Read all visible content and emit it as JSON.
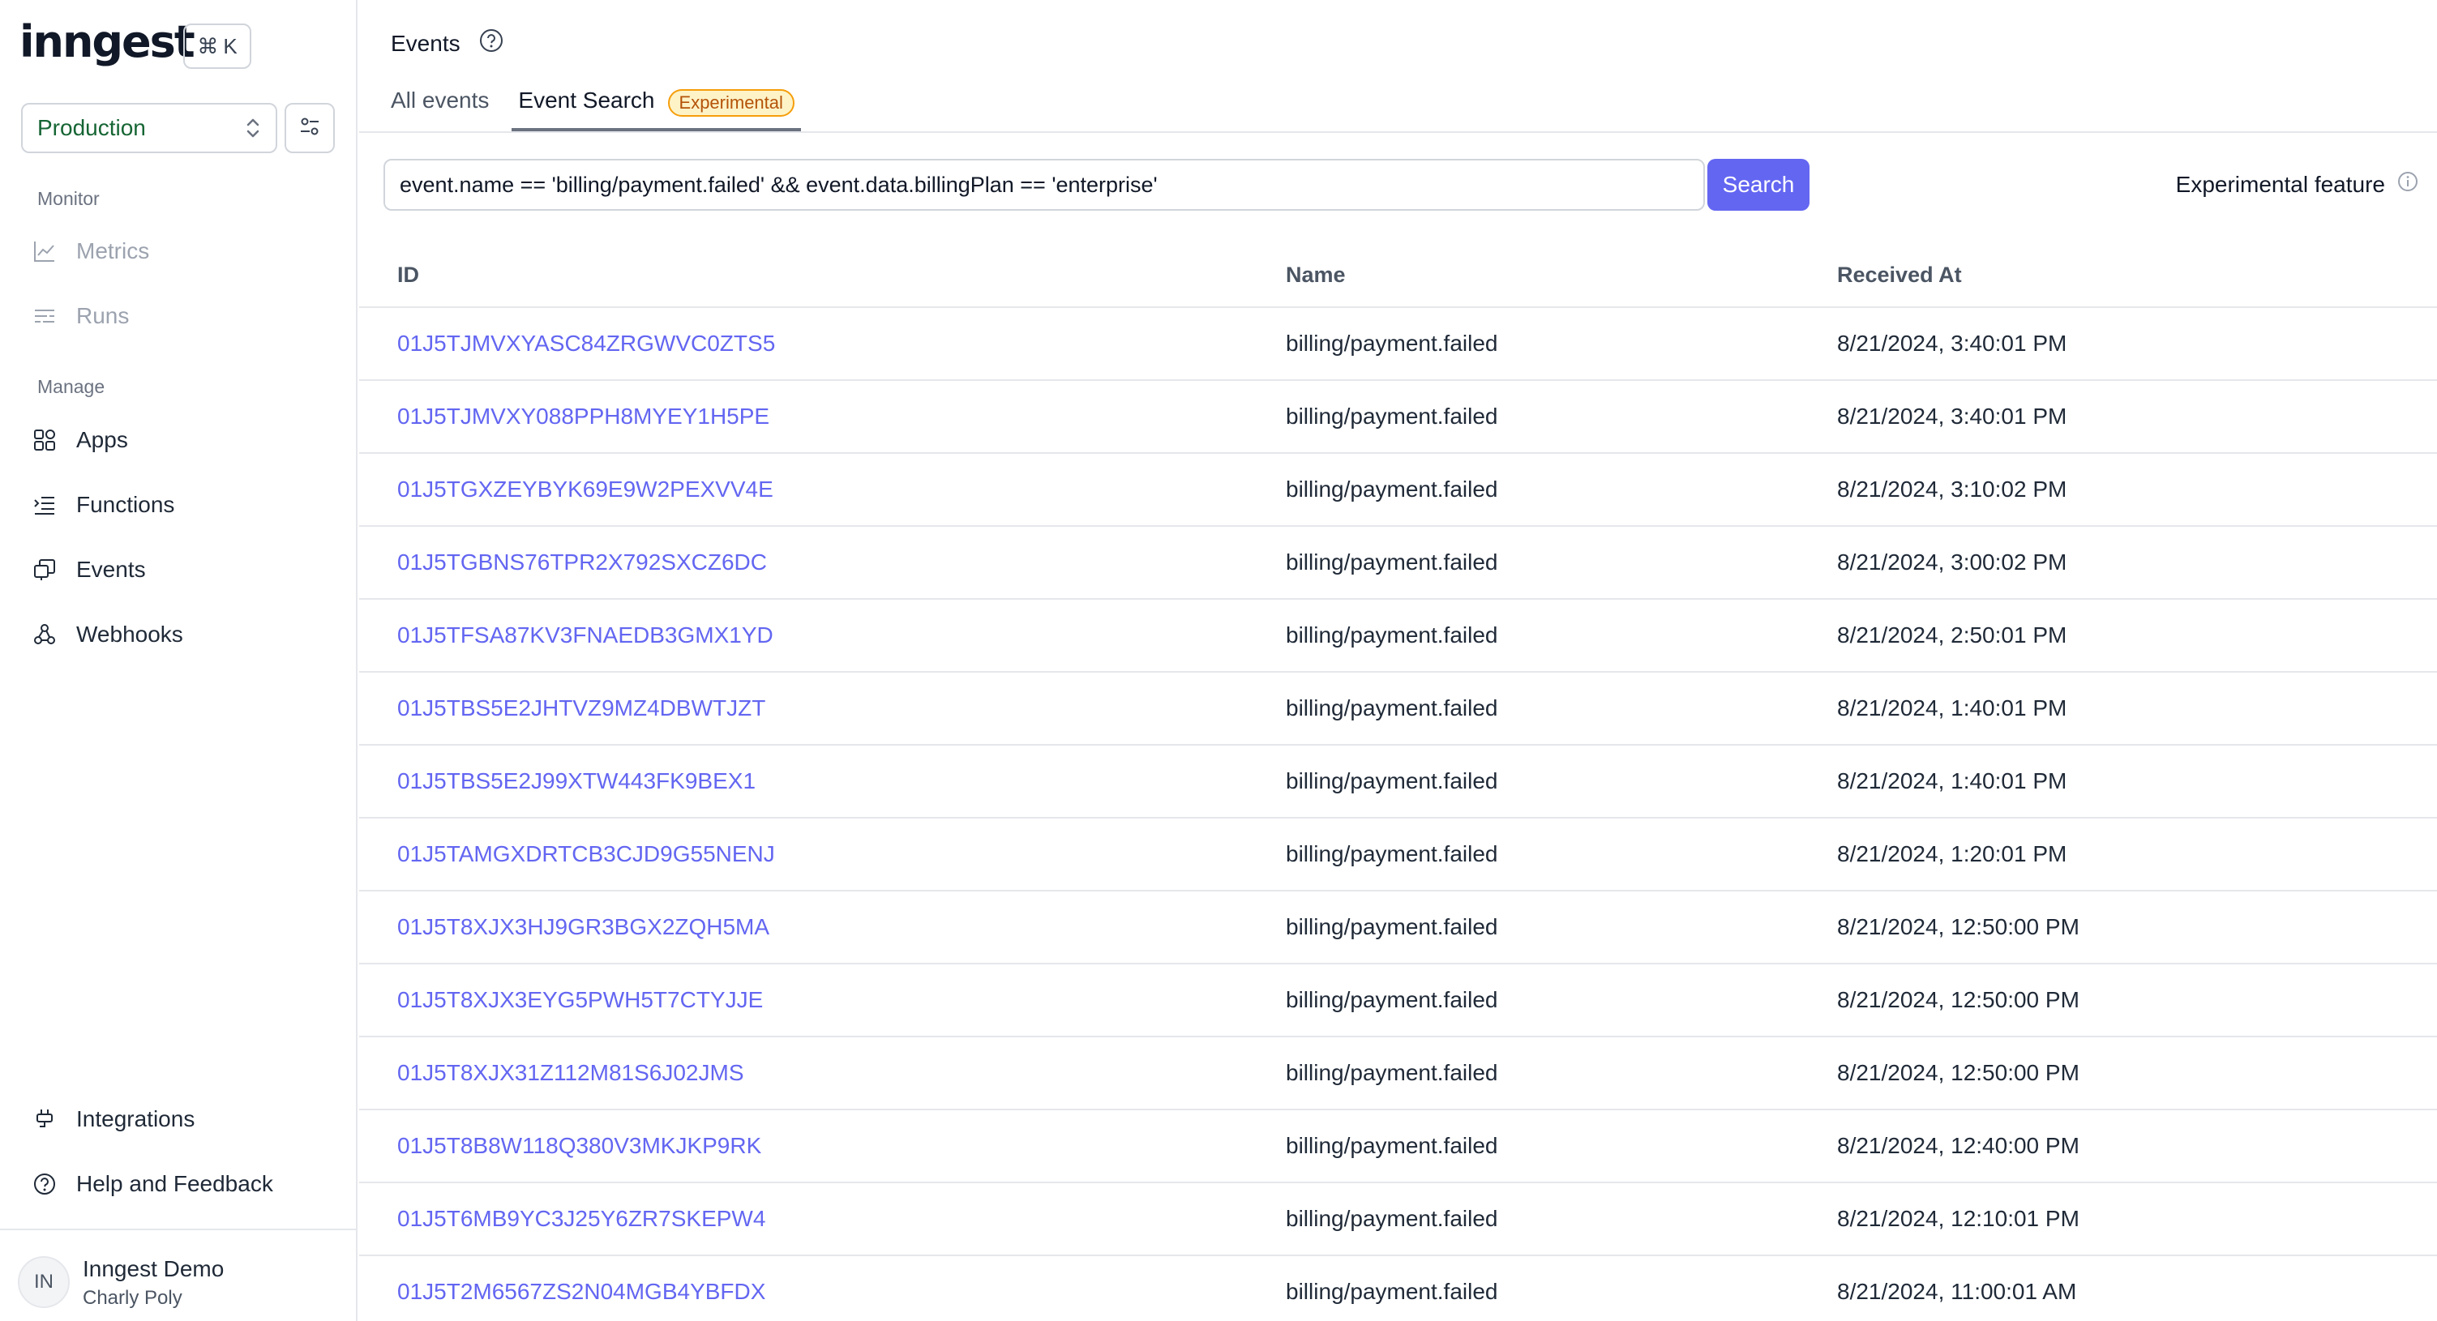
{
  "sidebar": {
    "logo": "inngest",
    "shortcut": {
      "symbol": "⌘",
      "key": "K"
    },
    "environment": "Production",
    "sections": {
      "monitor": "Monitor",
      "manage": "Manage"
    },
    "monitor_items": [
      {
        "label": "Metrics",
        "icon": "chart-icon"
      },
      {
        "label": "Runs",
        "icon": "runs-icon"
      }
    ],
    "manage_items": [
      {
        "label": "Apps",
        "icon": "apps-icon"
      },
      {
        "label": "Functions",
        "icon": "functions-icon"
      },
      {
        "label": "Events",
        "icon": "events-icon"
      },
      {
        "label": "Webhooks",
        "icon": "webhooks-icon"
      }
    ],
    "bottom_items": [
      {
        "label": "Integrations",
        "icon": "plug-icon"
      },
      {
        "label": "Help and Feedback",
        "icon": "help-icon"
      }
    ],
    "user": {
      "initials": "IN",
      "name": "Inngest Demo",
      "subtitle": "Charly Poly"
    }
  },
  "header": {
    "title": "Events",
    "tabs": [
      {
        "label": "All events"
      },
      {
        "label": "Event Search",
        "badge": "Experimental",
        "active": true
      }
    ]
  },
  "search": {
    "query": "event.name == 'billing/payment.failed' && event.data.billingPlan == 'enterprise'",
    "button": "Search",
    "experimental_label": "Experimental feature"
  },
  "table": {
    "columns": [
      "ID",
      "Name",
      "Received At"
    ],
    "rows": [
      [
        "01J5TJMVXYASC84ZRGWVC0ZTS5",
        "billing/payment.failed",
        "8/21/2024, 3:40:01 PM"
      ],
      [
        "01J5TJMVXY088PPH8MYEY1H5PE",
        "billing/payment.failed",
        "8/21/2024, 3:40:01 PM"
      ],
      [
        "01J5TGXZEYBYK69E9W2PEXVV4E",
        "billing/payment.failed",
        "8/21/2024, 3:10:02 PM"
      ],
      [
        "01J5TGBNS76TPR2X792SXCZ6DC",
        "billing/payment.failed",
        "8/21/2024, 3:00:02 PM"
      ],
      [
        "01J5TFSA87KV3FNAEDB3GMX1YD",
        "billing/payment.failed",
        "8/21/2024, 2:50:01 PM"
      ],
      [
        "01J5TBS5E2JHTVZ9MZ4DBWTJZT",
        "billing/payment.failed",
        "8/21/2024, 1:40:01 PM"
      ],
      [
        "01J5TBS5E2J99XTW443FK9BEX1",
        "billing/payment.failed",
        "8/21/2024, 1:40:01 PM"
      ],
      [
        "01J5TAMGXDRTCB3CJD9G55NENJ",
        "billing/payment.failed",
        "8/21/2024, 1:20:01 PM"
      ],
      [
        "01J5T8XJX3HJ9GR3BGX2ZQH5MA",
        "billing/payment.failed",
        "8/21/2024, 12:50:00 PM"
      ],
      [
        "01J5T8XJX3EYG5PWH5T7CTYJJE",
        "billing/payment.failed",
        "8/21/2024, 12:50:00 PM"
      ],
      [
        "01J5T8XJX31Z112M81S6J02JMS",
        "billing/payment.failed",
        "8/21/2024, 12:50:00 PM"
      ],
      [
        "01J5T8B8W118Q380V3MKJKP9RK",
        "billing/payment.failed",
        "8/21/2024, 12:40:00 PM"
      ],
      [
        "01J5T6MB9YC3J25Y6ZR7SKEPW4",
        "billing/payment.failed",
        "8/21/2024, 12:10:01 PM"
      ],
      [
        "01J5T2M6567ZS2N04MGB4YBFDX",
        "billing/payment.failed",
        "8/21/2024, 11:00:01 AM"
      ]
    ]
  }
}
